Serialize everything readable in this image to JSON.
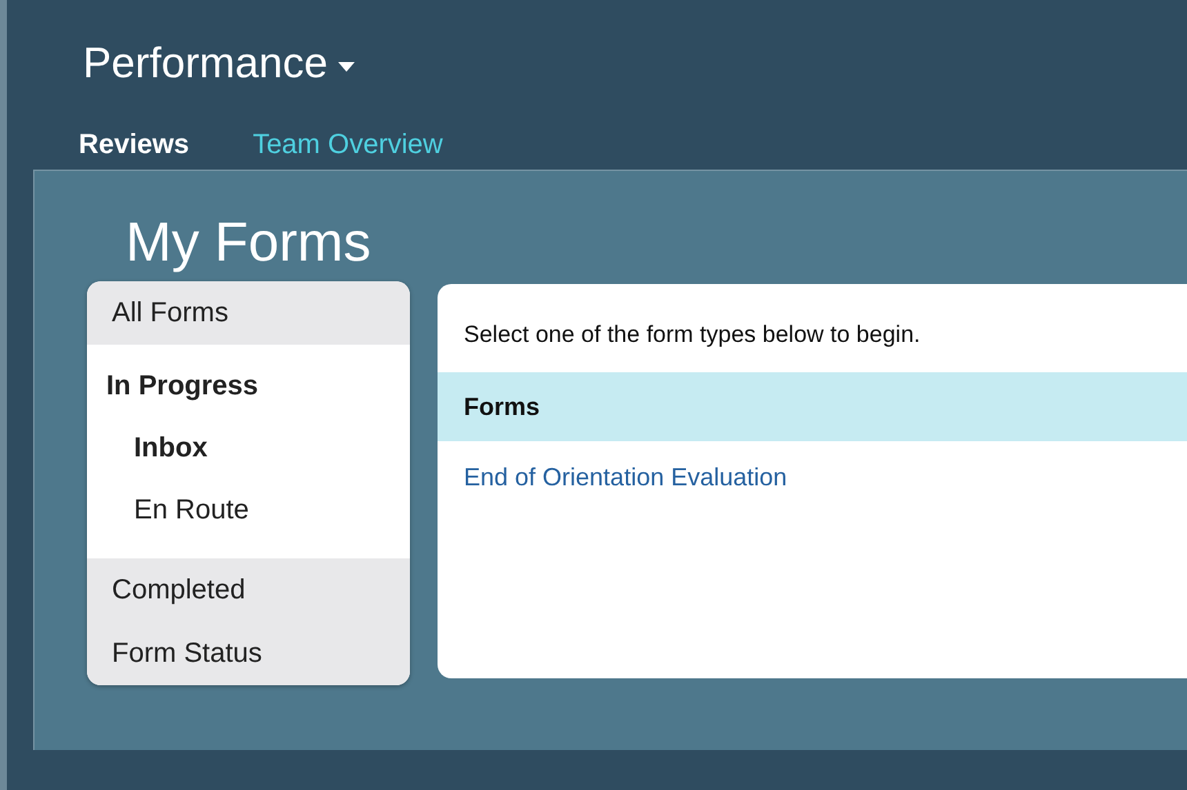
{
  "header": {
    "title": "Performance"
  },
  "tabs": [
    {
      "label": "Reviews",
      "selected": true
    },
    {
      "label": "Team Overview",
      "selected": false
    }
  ],
  "page_title": "My Forms",
  "sidebar": {
    "items": [
      {
        "label": "All Forms",
        "kind": "section"
      },
      {
        "label": "In Progress",
        "kind": "group",
        "children": [
          {
            "label": "Inbox",
            "selected": true
          },
          {
            "label": "En Route",
            "selected": false
          }
        ]
      },
      {
        "label": "Completed",
        "kind": "section"
      },
      {
        "label": "Form Status",
        "kind": "section"
      }
    ]
  },
  "main": {
    "intro": "Select one of the form types below to begin.",
    "table": {
      "heading": "Forms",
      "rows": [
        "End of Orientation Evaluation"
      ]
    }
  }
}
